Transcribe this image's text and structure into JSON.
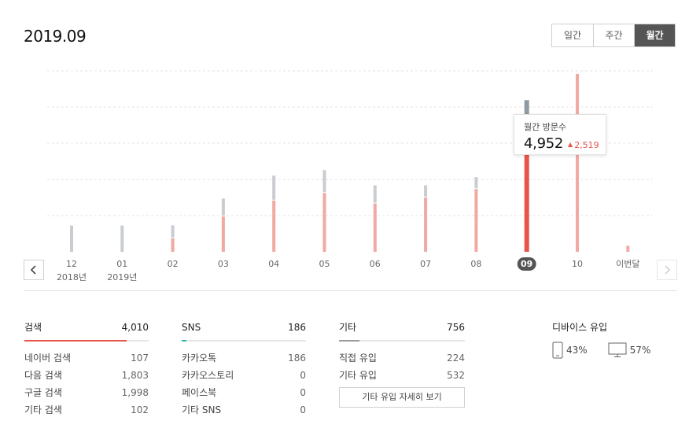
{
  "page": {
    "title": "2019.09"
  },
  "period_tabs": [
    {
      "label": "일간",
      "active": false
    },
    {
      "label": "주간",
      "active": false
    },
    {
      "label": "월간",
      "active": true
    }
  ],
  "tooltip": {
    "label": "월간 방문수",
    "value": "4,952",
    "change": "2,519"
  },
  "chart_data": {
    "type": "bar",
    "categories": [
      "12",
      "01",
      "02",
      "03",
      "04",
      "05",
      "06",
      "07",
      "08",
      "09",
      "10",
      "이번달"
    ],
    "category_sublabels": [
      "2018년",
      "2019년",
      "",
      "",
      "",
      "",
      "",
      "",
      "",
      "",
      "",
      ""
    ],
    "selected_index": 9,
    "series": [
      {
        "values": [
          0,
          0,
          450,
          1170,
          1700,
          1950,
          1600,
          1800,
          2080,
          4230,
          5900,
          200
        ]
      },
      {
        "values": [
          870,
          870,
          400,
          570,
          800,
          730,
          580,
          380,
          370,
          720,
          0,
          0
        ]
      }
    ],
    "ylim": [
      0,
      6000
    ],
    "grid": true,
    "colors": {
      "selected": "#e8534a",
      "normal": "#f1a9a2",
      "secondary": "#c9ccd0",
      "secondary_selected": "#8f9aa3",
      "separator": "#2bb9a5"
    }
  },
  "breakdown": {
    "search": {
      "title": "검색",
      "total": "4,010",
      "ratio": 0.82,
      "color": "#e8534a",
      "items": [
        {
          "label": "네이버 검색",
          "value": "107"
        },
        {
          "label": "다음 검색",
          "value": "1,803"
        },
        {
          "label": "구글 검색",
          "value": "1,998"
        },
        {
          "label": "기타 검색",
          "value": "102"
        }
      ]
    },
    "sns": {
      "title": "SNS",
      "total": "186",
      "ratio": 0.04,
      "color": "#2bb9a5",
      "items": [
        {
          "label": "카카오톡",
          "value": "186"
        },
        {
          "label": "카카오스토리",
          "value": "0"
        },
        {
          "label": "페이스북",
          "value": "0"
        },
        {
          "label": "기타 SNS",
          "value": "0"
        }
      ]
    },
    "other": {
      "title": "기타",
      "total": "756",
      "ratio": 0.16,
      "color": "#999999",
      "items": [
        {
          "label": "직접 유입",
          "value": "224"
        },
        {
          "label": "기타 유입",
          "value": "532"
        }
      ],
      "detail_button": "기타 유입 자세히 보기"
    }
  },
  "device": {
    "title": "디바이스 유입",
    "mobile": {
      "icon": "mobile-icon",
      "value": "43%"
    },
    "pc": {
      "icon": "monitor-icon",
      "value": "57%"
    }
  }
}
